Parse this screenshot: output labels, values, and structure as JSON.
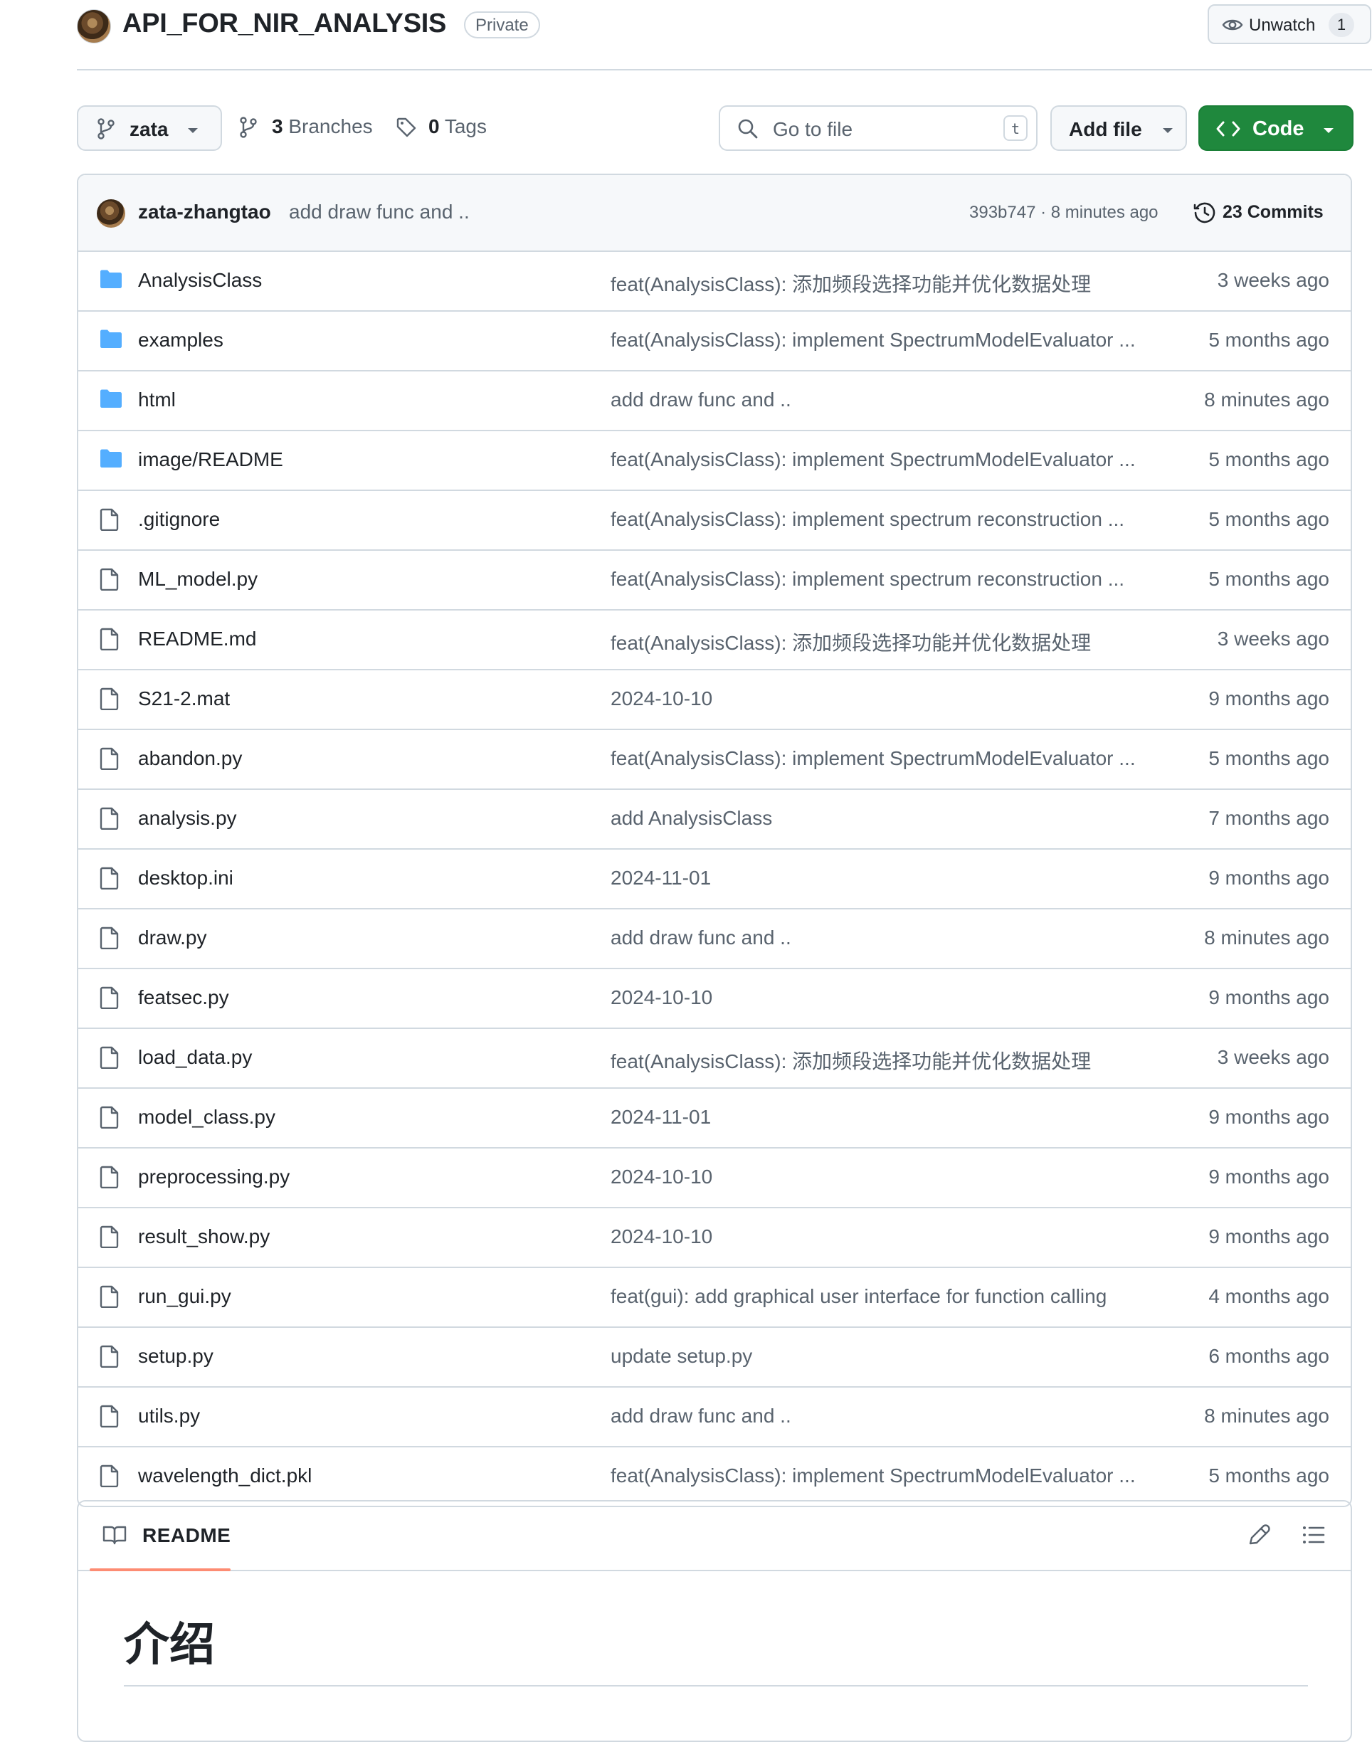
{
  "repo": {
    "name": "API_FOR_NIR_ANALYSIS",
    "visibility": "Private",
    "watch_label": "Unwatch",
    "watch_count": "1"
  },
  "toolbar": {
    "branch": "zata",
    "branches_count": "3",
    "branches_label": "Branches",
    "tags_count": "0",
    "tags_label": "Tags",
    "search_placeholder": "Go to file",
    "search_shortcut": "t",
    "add_file_label": "Add file",
    "code_label": "Code"
  },
  "latest_commit": {
    "author": "zata-zhangtao",
    "message": "add draw func and ..",
    "sha_time": "393b747 · 8 minutes ago",
    "commits_label": "23 Commits"
  },
  "files": [
    {
      "type": "dir",
      "name": "AnalysisClass",
      "message": "feat(AnalysisClass): 添加频段选择功能并优化数据处理",
      "age": "3 weeks ago"
    },
    {
      "type": "dir",
      "name": "examples",
      "message": "feat(AnalysisClass): implement SpectrumModelEvaluator ...",
      "age": "5 months ago"
    },
    {
      "type": "dir",
      "name": "html",
      "message": "add draw func and ..",
      "age": "8 minutes ago"
    },
    {
      "type": "dir",
      "name": "image/README",
      "message": "feat(AnalysisClass): implement SpectrumModelEvaluator ...",
      "age": "5 months ago"
    },
    {
      "type": "file",
      "name": ".gitignore",
      "message": "feat(AnalysisClass): implement spectrum reconstruction ...",
      "age": "5 months ago"
    },
    {
      "type": "file",
      "name": "ML_model.py",
      "message": "feat(AnalysisClass): implement spectrum reconstruction ...",
      "age": "5 months ago"
    },
    {
      "type": "file",
      "name": "README.md",
      "message": "feat(AnalysisClass): 添加频段选择功能并优化数据处理",
      "age": "3 weeks ago"
    },
    {
      "type": "file",
      "name": "S21-2.mat",
      "message": "2024-10-10",
      "age": "9 months ago"
    },
    {
      "type": "file",
      "name": "abandon.py",
      "message": "feat(AnalysisClass): implement SpectrumModelEvaluator ...",
      "age": "5 months ago"
    },
    {
      "type": "file",
      "name": "analysis.py",
      "message": "add AnalysisClass",
      "age": "7 months ago"
    },
    {
      "type": "file",
      "name": "desktop.ini",
      "message": "2024-11-01",
      "age": "9 months ago"
    },
    {
      "type": "file",
      "name": "draw.py",
      "message": "add draw func and ..",
      "age": "8 minutes ago"
    },
    {
      "type": "file",
      "name": "featsec.py",
      "message": "2024-10-10",
      "age": "9 months ago"
    },
    {
      "type": "file",
      "name": "load_data.py",
      "message": "feat(AnalysisClass): 添加频段选择功能并优化数据处理",
      "age": "3 weeks ago"
    },
    {
      "type": "file",
      "name": "model_class.py",
      "message": "2024-11-01",
      "age": "9 months ago"
    },
    {
      "type": "file",
      "name": "preprocessing.py",
      "message": "2024-10-10",
      "age": "9 months ago"
    },
    {
      "type": "file",
      "name": "result_show.py",
      "message": "2024-10-10",
      "age": "9 months ago"
    },
    {
      "type": "file",
      "name": "run_gui.py",
      "message": "feat(gui): add graphical user interface for function calling",
      "age": "4 months ago"
    },
    {
      "type": "file",
      "name": "setup.py",
      "message": "update setup.py",
      "age": "6 months ago"
    },
    {
      "type": "file",
      "name": "utils.py",
      "message": "add draw func and ..",
      "age": "8 minutes ago"
    },
    {
      "type": "file",
      "name": "wavelength_dict.pkl",
      "message": "feat(AnalysisClass): implement SpectrumModelEvaluator ...",
      "age": "5 months ago"
    }
  ],
  "readme": {
    "tab_label": "README",
    "heading": "介绍"
  },
  "colors": {
    "folder": "#54aeff",
    "primary_button": "#1f883d",
    "tab_underline": "#fd8c73",
    "border": "#d1d9e0",
    "muted_text": "#59636e"
  },
  "icons": {
    "dir": "folder-icon",
    "file": "file-icon"
  }
}
